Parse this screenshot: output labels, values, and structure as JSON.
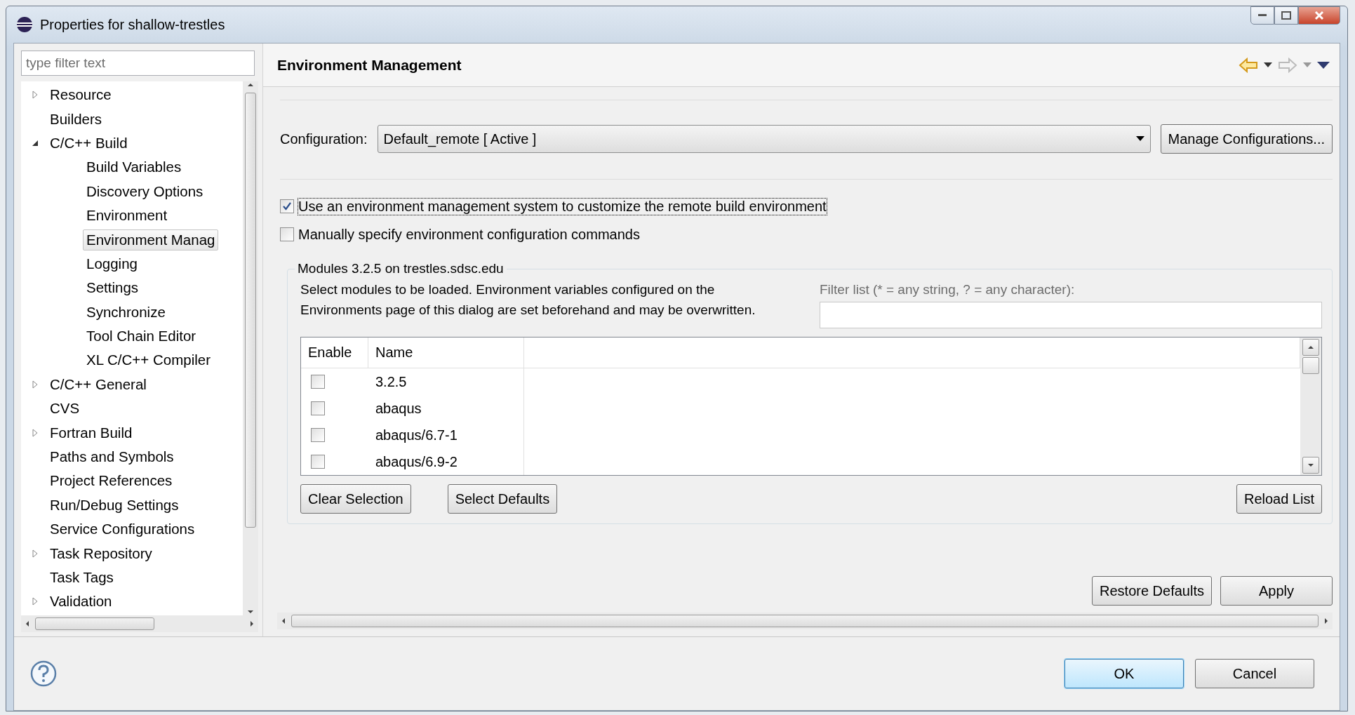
{
  "window": {
    "title": "Properties for shallow-trestles"
  },
  "sidebar": {
    "filter": {
      "placeholder": "type filter text"
    },
    "items": [
      {
        "label": "Resource",
        "expandable": true,
        "expanded": false,
        "selected": false
      },
      {
        "label": "Builders",
        "expandable": false,
        "selected": false
      },
      {
        "label": "C/C++ Build",
        "expandable": true,
        "expanded": true,
        "selected": false,
        "children": [
          {
            "label": "Build Variables",
            "selected": false
          },
          {
            "label": "Discovery Options",
            "selected": false
          },
          {
            "label": "Environment",
            "selected": false
          },
          {
            "label": "Environment Manag",
            "selected": true
          },
          {
            "label": "Logging",
            "selected": false
          },
          {
            "label": "Settings",
            "selected": false
          },
          {
            "label": "Synchronize",
            "selected": false
          },
          {
            "label": "Tool Chain Editor",
            "selected": false
          },
          {
            "label": "XL C/C++ Compiler",
            "selected": false
          }
        ]
      },
      {
        "label": "C/C++ General",
        "expandable": true,
        "expanded": false,
        "selected": false
      },
      {
        "label": "CVS",
        "expandable": false,
        "selected": false
      },
      {
        "label": "Fortran Build",
        "expandable": true,
        "expanded": false,
        "selected": false
      },
      {
        "label": "Paths and Symbols",
        "expandable": false,
        "selected": false
      },
      {
        "label": "Project References",
        "expandable": false,
        "selected": false
      },
      {
        "label": "Run/Debug Settings",
        "expandable": false,
        "selected": false
      },
      {
        "label": "Service Configurations",
        "expandable": false,
        "selected": false
      },
      {
        "label": "Task Repository",
        "expandable": true,
        "expanded": false,
        "selected": false
      },
      {
        "label": "Task Tags",
        "expandable": false,
        "selected": false
      },
      {
        "label": "Validation",
        "expandable": true,
        "expanded": false,
        "selected": false
      }
    ]
  },
  "page": {
    "title": "Environment Management",
    "configuration": {
      "label": "Configuration:",
      "value": "Default_remote  [ Active ]",
      "button": "Manage Configurations..."
    },
    "options": [
      {
        "label": "Use an environment management system to customize the remote build environment",
        "checked": true,
        "focused": true
      },
      {
        "label": "Manually specify environment configuration commands",
        "checked": false,
        "focused": false
      }
    ],
    "modules": {
      "title": "Modules 3.2.5 on trestles.sdsc.edu",
      "description": "Select modules to be loaded.  Environment variables configured on the Environments page of this dialog are set beforehand and may be overwritten.",
      "filter_label": "Filter list (* = any string, ? = any character):",
      "columns": [
        "Enable",
        "Name"
      ],
      "rows": [
        {
          "name": "3.2.5",
          "checked": false
        },
        {
          "name": "abaqus",
          "checked": false
        },
        {
          "name": "abaqus/6.7-1",
          "checked": false
        },
        {
          "name": "abaqus/6.9-2",
          "checked": false
        }
      ],
      "buttons": [
        "Clear Selection",
        "Select Defaults"
      ],
      "reload": "Reload List"
    },
    "buttons": [
      "Restore Defaults",
      "Apply"
    ]
  },
  "footer": {
    "buttons": [
      {
        "label": "OK",
        "default": true
      },
      {
        "label": "Cancel",
        "default": false
      }
    ]
  }
}
